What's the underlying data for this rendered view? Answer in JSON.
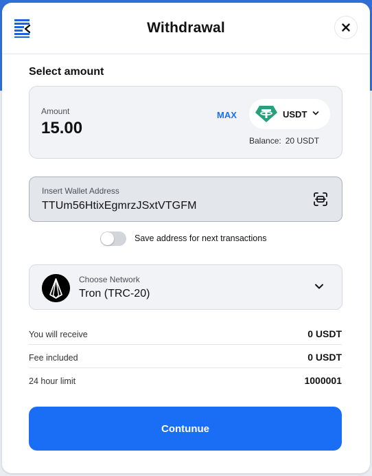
{
  "header": {
    "title": "Withdrawal",
    "close_icon": "close-icon",
    "logo_icon": "exchange-logo-icon"
  },
  "amount_section": {
    "title": "Select amount",
    "amount_label": "Amount",
    "amount_value": "15.00",
    "max_label": "MAX",
    "currency": "USDT",
    "currency_icon": "tether-icon",
    "balance_label": "Balance:",
    "balance_value": "20 USDT"
  },
  "wallet": {
    "label": "Insert Wallet Address",
    "value": "TTUm56HtixEgmrzJSxtVTGFM",
    "scan_icon": "scan-icon"
  },
  "save_toggle": {
    "label": "Save address for next transactions",
    "checked": false
  },
  "network": {
    "label": "Choose Network",
    "value": "Tron (TRC-20)",
    "icon": "tron-icon"
  },
  "summary": {
    "receive": {
      "label": "You will receive",
      "value": "0 USDT"
    },
    "fee": {
      "label": "Fee included",
      "value": "0 USDT"
    },
    "limit": {
      "label": "24 hour limit",
      "value": "1000001"
    }
  },
  "continue_label": "Contunue",
  "colors": {
    "accent": "#1a6ef5",
    "tether": "#26a17b",
    "background_top": "#2f6fd6"
  }
}
